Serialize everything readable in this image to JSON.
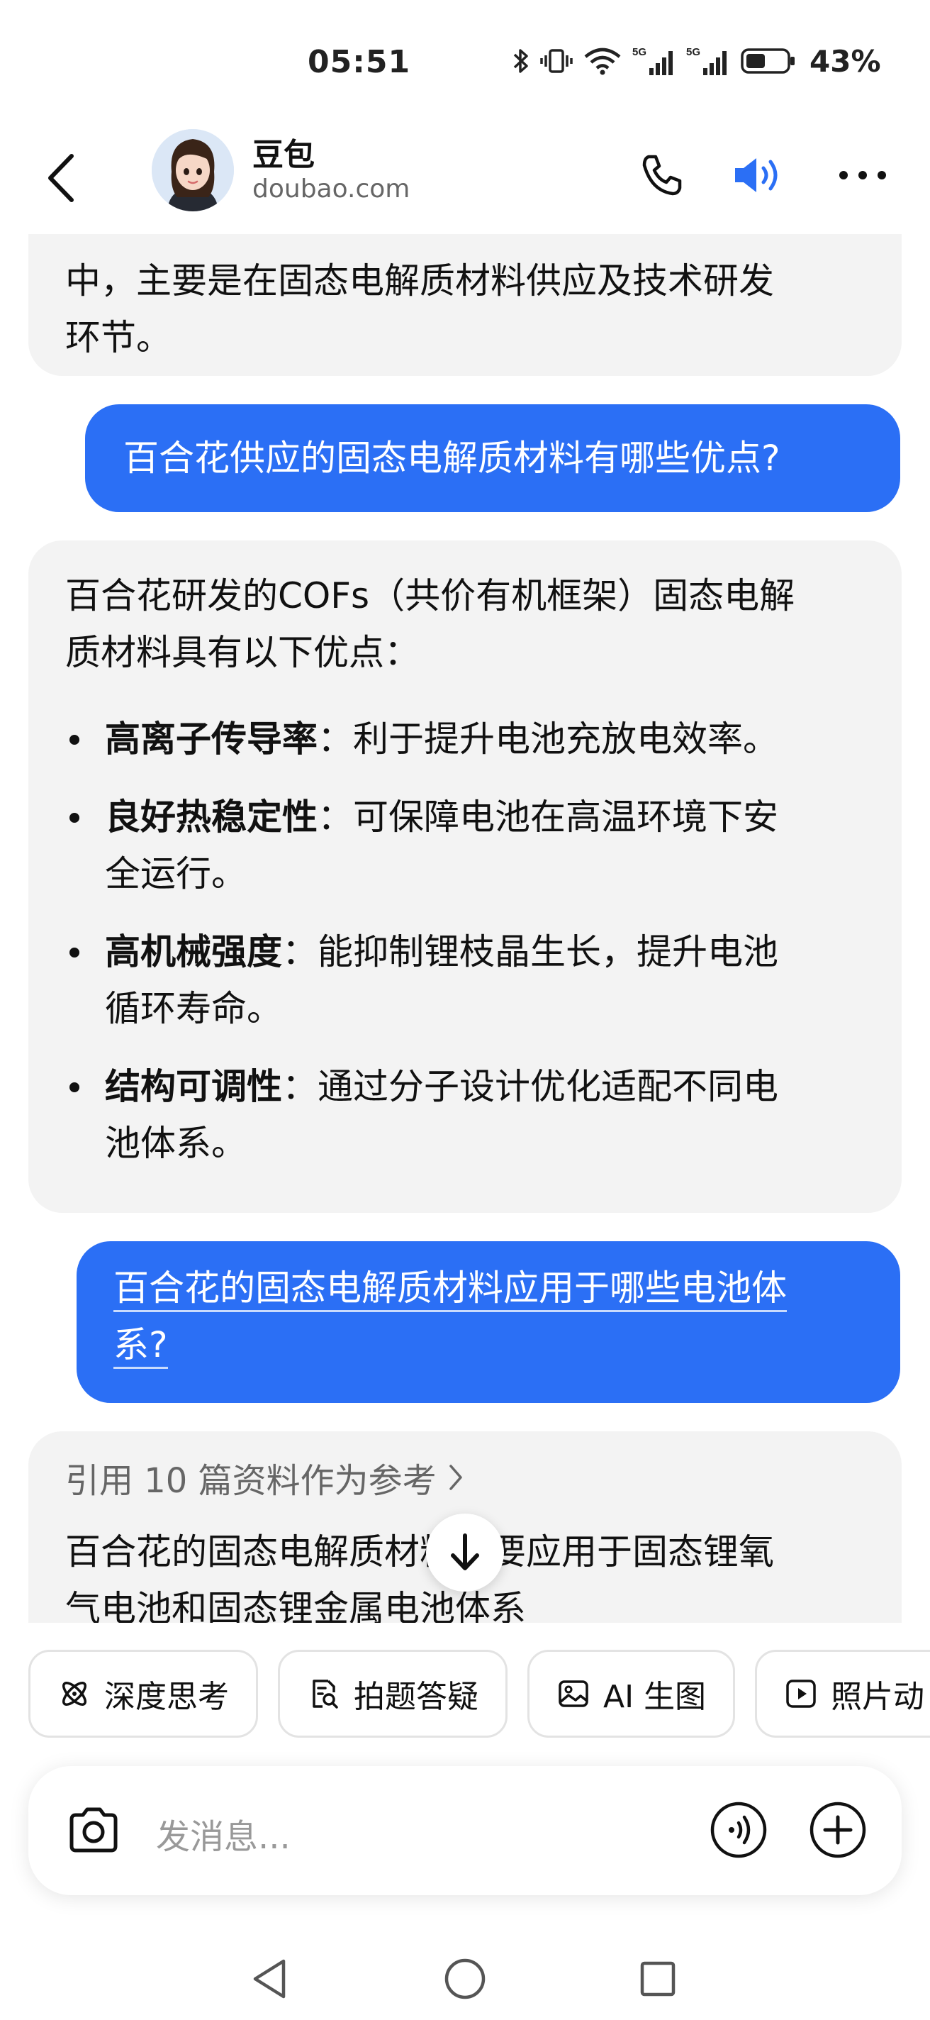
{
  "status_bar": {
    "time": "05:51",
    "signal_1_label": "5G",
    "signal_2_label": "5G",
    "battery": "43%"
  },
  "header": {
    "name": "豆包",
    "domain": "doubao.com"
  },
  "messages": {
    "ai_1_lines": [
      "中，主要是在固态电解质材料供应及技术研发",
      "环节。"
    ],
    "user_1": "百合花供应的固态电解质材料有哪些优点?",
    "ai_2_intro_lines": [
      "百合花研发的COFs（共价有机框架）固态电解",
      "质材料具有以下优点："
    ],
    "ai_2_bullets": [
      {
        "title": "高离子传导率",
        "lines": [
          "：利于提升电池充放电效率。"
        ]
      },
      {
        "title": "良好热稳定性",
        "lines": [
          "：可保障电池在高温环境下安",
          "全运行。"
        ]
      },
      {
        "title": "高机械强度",
        "lines": [
          "：能抑制锂枝晶生长，提升电池",
          "循环寿命。"
        ]
      },
      {
        "title": "结构可调性",
        "lines": [
          "：通过分子设计优化适配不同电",
          "池体系。"
        ]
      }
    ],
    "user_2_lines": [
      "百合花的固态电解质材料应用于哪些电池体",
      "系? "
    ],
    "ai_3_ref": "引用 10 篇资料作为参考",
    "ai_3_lines": [
      "百合花的固态电解质材料主要应用于固态锂氧",
      "气电池和固态锂金属电池体系"
    ]
  },
  "chips": [
    "深度思考",
    "拍题答疑",
    "AI 生图",
    "照片动"
  ],
  "input": {
    "placeholder": "发消息..."
  },
  "colors": {
    "accent": "#2b6ff5",
    "ai_bubble": "#f3f3f3"
  }
}
